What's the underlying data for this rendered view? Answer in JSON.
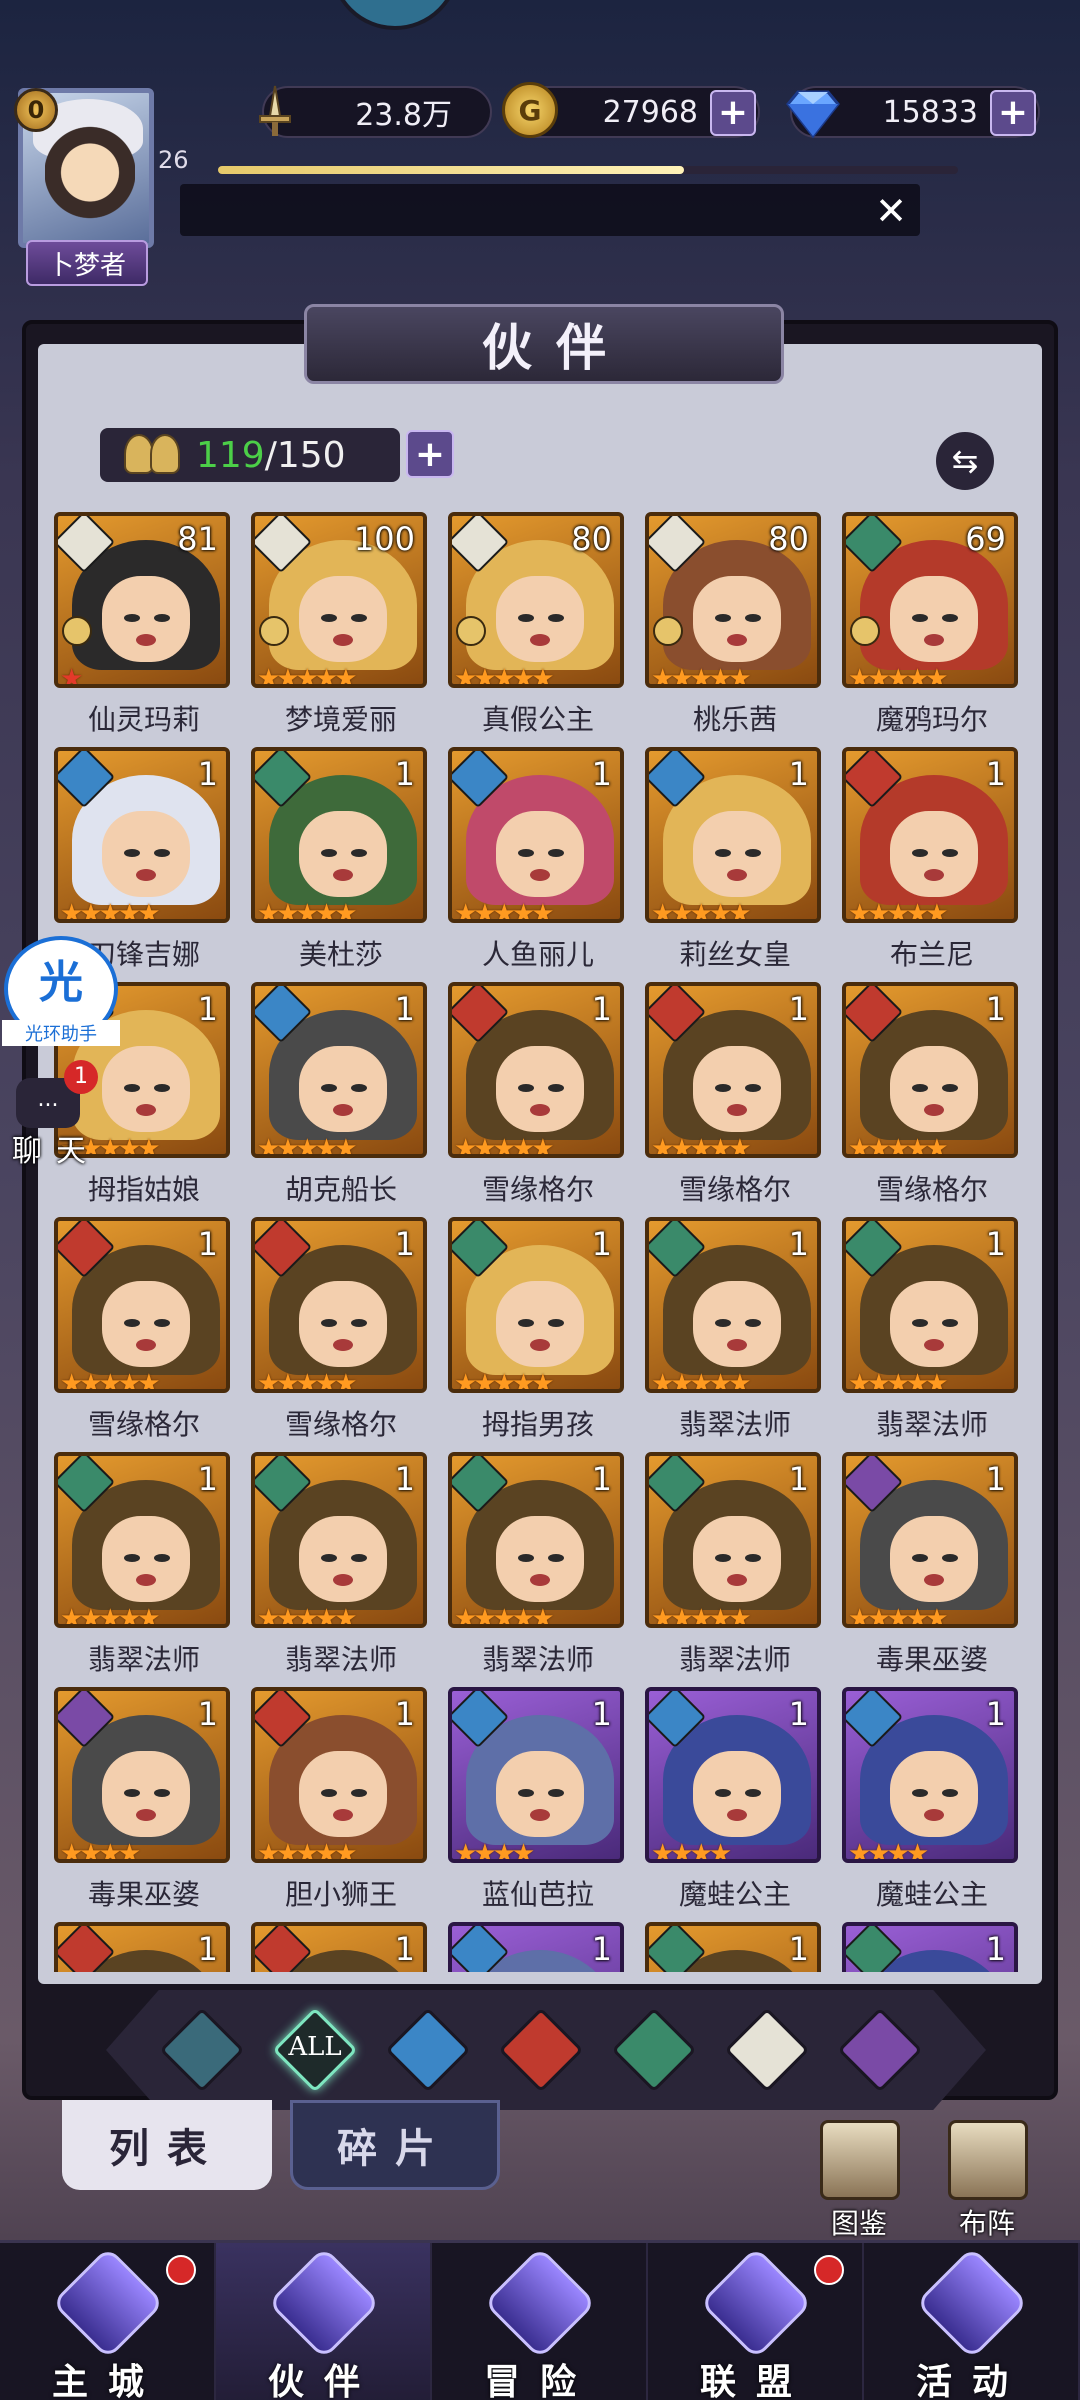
{
  "header": {
    "vip_level": "0",
    "player_level": "26",
    "title_tag": "卜梦者",
    "power": "23.8万",
    "gold": "27968",
    "gems": "15833",
    "xp_progress": 0.63
  },
  "panel": {
    "title": "伙伴",
    "count_current": "119",
    "count_max": "/150"
  },
  "heroes": [
    {
      "name": "仙灵玛莉",
      "level": "81",
      "element": "light",
      "hair": "black",
      "frame": "orange",
      "rank": true,
      "stars": 1,
      "star_color": "red"
    },
    {
      "name": "梦境爱丽",
      "level": "100",
      "element": "light",
      "hair": "blond",
      "frame": "orange",
      "rank": true,
      "stars": 5,
      "star_color": "orange"
    },
    {
      "name": "真假公主",
      "level": "80",
      "element": "light",
      "hair": "blond",
      "frame": "orange",
      "rank": true,
      "stars": 5,
      "star_color": "orange"
    },
    {
      "name": "桃乐茜",
      "level": "80",
      "element": "light",
      "hair": "brown",
      "frame": "orange",
      "rank": true,
      "stars": 5,
      "star_color": "orange"
    },
    {
      "name": "魔鸦玛尔",
      "level": "69",
      "element": "wind",
      "hair": "red",
      "frame": "orange",
      "rank": true,
      "stars": 5,
      "star_color": "orange"
    },
    {
      "name": "刀锋吉娜",
      "level": "1",
      "element": "water",
      "hair": "white",
      "frame": "orange",
      "rank": false,
      "stars": 5,
      "star_color": "orange"
    },
    {
      "name": "美杜莎",
      "level": "1",
      "element": "wind",
      "hair": "green",
      "frame": "orange",
      "rank": false,
      "stars": 5,
      "star_color": "orange"
    },
    {
      "name": "人鱼丽儿",
      "level": "1",
      "element": "water",
      "hair": "pink",
      "frame": "orange",
      "rank": false,
      "stars": 5,
      "star_color": "orange"
    },
    {
      "name": "莉丝女皇",
      "level": "1",
      "element": "water",
      "hair": "blond",
      "frame": "orange",
      "rank": false,
      "stars": 5,
      "star_color": "orange"
    },
    {
      "name": "布兰尼",
      "level": "1",
      "element": "fire",
      "hair": "red",
      "frame": "orange",
      "rank": false,
      "stars": 5,
      "star_color": "orange"
    },
    {
      "name": "拇指姑娘",
      "level": "1",
      "element": "water",
      "hair": "blond",
      "frame": "orange",
      "rank": false,
      "stars": 5,
      "star_color": "orange"
    },
    {
      "name": "胡克船长",
      "level": "1",
      "element": "water",
      "hair": "grey",
      "frame": "orange",
      "rank": false,
      "stars": 5,
      "star_color": "orange"
    },
    {
      "name": "雪缘格尔",
      "level": "1",
      "element": "fire",
      "hair": "hat",
      "frame": "orange",
      "rank": false,
      "stars": 5,
      "star_color": "orange"
    },
    {
      "name": "雪缘格尔",
      "level": "1",
      "element": "fire",
      "hair": "hat",
      "frame": "orange",
      "rank": false,
      "stars": 5,
      "star_color": "orange"
    },
    {
      "name": "雪缘格尔",
      "level": "1",
      "element": "fire",
      "hair": "hat",
      "frame": "orange",
      "rank": false,
      "stars": 5,
      "star_color": "orange"
    },
    {
      "name": "雪缘格尔",
      "level": "1",
      "element": "fire",
      "hair": "hat",
      "frame": "orange",
      "rank": false,
      "stars": 5,
      "star_color": "orange"
    },
    {
      "name": "雪缘格尔",
      "level": "1",
      "element": "fire",
      "hair": "hat",
      "frame": "orange",
      "rank": false,
      "stars": 5,
      "star_color": "orange"
    },
    {
      "name": "拇指男孩",
      "level": "1",
      "element": "wind",
      "hair": "blond",
      "frame": "orange",
      "rank": false,
      "stars": 5,
      "star_color": "orange"
    },
    {
      "name": "翡翠法师",
      "level": "1",
      "element": "wind",
      "hair": "hat",
      "frame": "orange",
      "rank": false,
      "stars": 5,
      "star_color": "orange"
    },
    {
      "name": "翡翠法师",
      "level": "1",
      "element": "wind",
      "hair": "hat",
      "frame": "orange",
      "rank": false,
      "stars": 5,
      "star_color": "orange"
    },
    {
      "name": "翡翠法师",
      "level": "1",
      "element": "wind",
      "hair": "hat",
      "frame": "orange",
      "rank": false,
      "stars": 5,
      "star_color": "orange"
    },
    {
      "name": "翡翠法师",
      "level": "1",
      "element": "wind",
      "hair": "hat",
      "frame": "orange",
      "rank": false,
      "stars": 5,
      "star_color": "orange"
    },
    {
      "name": "翡翠法师",
      "level": "1",
      "element": "wind",
      "hair": "hat",
      "frame": "orange",
      "rank": false,
      "stars": 5,
      "star_color": "orange"
    },
    {
      "name": "翡翠法师",
      "level": "1",
      "element": "wind",
      "hair": "hat",
      "frame": "orange",
      "rank": false,
      "stars": 5,
      "star_color": "orange"
    },
    {
      "name": "毒果巫婆",
      "level": "1",
      "element": "dark",
      "hair": "grey",
      "frame": "orange",
      "rank": false,
      "stars": 5,
      "star_color": "orange"
    },
    {
      "name": "毒果巫婆",
      "level": "1",
      "element": "dark",
      "hair": "grey",
      "frame": "orange",
      "rank": false,
      "stars": 4,
      "star_color": "orange"
    },
    {
      "name": "胆小狮王",
      "level": "1",
      "element": "fire",
      "hair": "brown",
      "frame": "orange",
      "rank": false,
      "stars": 5,
      "star_color": "orange"
    },
    {
      "name": "蓝仙芭拉",
      "level": "1",
      "element": "water",
      "hair": "blue",
      "frame": "purple",
      "rank": false,
      "stars": 4,
      "star_color": "orange"
    },
    {
      "name": "魔蛙公主",
      "level": "1",
      "element": "water",
      "hair": "frog",
      "frame": "purple",
      "rank": false,
      "stars": 4,
      "star_color": "orange"
    },
    {
      "name": "魔蛙公主",
      "level": "1",
      "element": "water",
      "hair": "frog",
      "frame": "purple",
      "rank": false,
      "stars": 4,
      "star_color": "orange"
    },
    {
      "name": "",
      "level": "1",
      "element": "fire",
      "hair": "hat",
      "frame": "orange",
      "rank": false,
      "stars": 0,
      "star_color": "orange"
    },
    {
      "name": "",
      "level": "1",
      "element": "fire",
      "hair": "hat",
      "frame": "orange",
      "rank": false,
      "stars": 0,
      "star_color": "orange"
    },
    {
      "name": "",
      "level": "1",
      "element": "water",
      "hair": "blue",
      "frame": "purple",
      "rank": false,
      "stars": 0,
      "star_color": "orange"
    },
    {
      "name": "",
      "level": "1",
      "element": "wind",
      "hair": "hat",
      "frame": "orange",
      "rank": false,
      "stars": 0,
      "star_color": "orange"
    },
    {
      "name": "",
      "level": "1",
      "element": "wind",
      "hair": "frog",
      "frame": "purple",
      "rank": false,
      "stars": 0,
      "star_color": "orange"
    }
  ],
  "filters": {
    "all_label": "ALL",
    "items": [
      "wind-dark",
      "all",
      "water",
      "fire",
      "wind",
      "light",
      "dark"
    ]
  },
  "subtabs": {
    "list": "列表",
    "fragments": "碎片"
  },
  "side_buttons": {
    "codex": "图鉴",
    "formation": "布阵"
  },
  "helper": {
    "badge": "光",
    "label": "光环助手"
  },
  "chat": {
    "label": "聊天",
    "unread": "1",
    "bubble": "..."
  },
  "nav": [
    {
      "label": "主城",
      "badge": true
    },
    {
      "label": "伙伴",
      "badge": false,
      "active": true
    },
    {
      "label": "冒险",
      "badge": false
    },
    {
      "label": "联盟",
      "badge": true
    },
    {
      "label": "活动",
      "badge": false
    }
  ],
  "colors": {
    "accent_purple": "#5c4a8c",
    "count_green": "#4ccf48",
    "star_orange": "#ff9a20",
    "notification_red": "#d62828"
  }
}
